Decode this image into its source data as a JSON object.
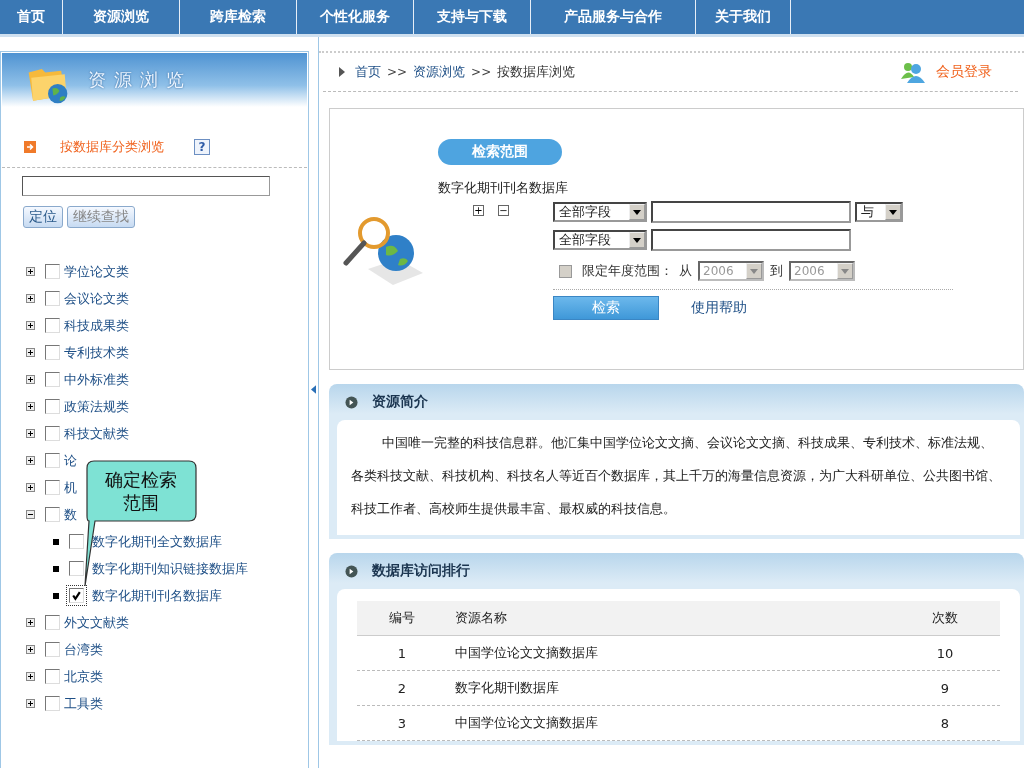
{
  "nav": [
    {
      "label": "首页"
    },
    {
      "label": "资源浏览"
    },
    {
      "label": "跨库检索"
    },
    {
      "label": "个性化服务"
    },
    {
      "label": "支持与下载"
    },
    {
      "label": "产品服务与合作"
    },
    {
      "label": "关于我们"
    }
  ],
  "sidebar": {
    "title": "资源浏览",
    "browse_link": "按数据库分类浏览",
    "help_icon": "?",
    "locate_button": "定位",
    "find_next_button": "继续查找",
    "tree": [
      {
        "label": "学位论文类",
        "expanded": false,
        "checked": false
      },
      {
        "label": "会议论文类",
        "expanded": false,
        "checked": false
      },
      {
        "label": "科技成果类",
        "expanded": false,
        "checked": false
      },
      {
        "label": "专利技术类",
        "expanded": false,
        "checked": false
      },
      {
        "label": "中外标准类",
        "expanded": false,
        "checked": false
      },
      {
        "label": "政策法规类",
        "expanded": false,
        "checked": false
      },
      {
        "label": "科技文献类",
        "expanded": false,
        "checked": false
      },
      {
        "label": "论",
        "expanded": false,
        "checked": false
      },
      {
        "label": "机",
        "expanded": false,
        "checked": false
      },
      {
        "label": "数",
        "expanded": true,
        "checked": false,
        "children": [
          {
            "label": "数字化期刊全文数据库",
            "checked": false
          },
          {
            "label": "数字化期刊知识链接数据库",
            "checked": false
          },
          {
            "label": "数字化期刊刊名数据库",
            "checked": true
          }
        ]
      },
      {
        "label": "外文文献类",
        "expanded": false,
        "checked": false
      },
      {
        "label": "台湾类",
        "expanded": false,
        "checked": false
      },
      {
        "label": "北京类",
        "expanded": false,
        "checked": false
      },
      {
        "label": "工具类",
        "expanded": false,
        "checked": false
      }
    ],
    "callout": "确定检索范围"
  },
  "breadcrumb": [
    {
      "label": "首页"
    },
    {
      "separator": ">>",
      "label": "资源浏览"
    },
    {
      "separator": ">>",
      "label": "按数据库浏览"
    }
  ],
  "login_link": "会员登录",
  "search": {
    "tag": "检索范围",
    "database": "数字化期刊刊名数据库",
    "add": "+",
    "remove": "−",
    "rows": [
      {
        "field": "全部字段",
        "value": "",
        "logic": "与"
      },
      {
        "field": "全部字段",
        "value": ""
      }
    ],
    "year_limit": {
      "checked": false,
      "label": "限定年度范围：",
      "from_label": "从",
      "from": "2006",
      "to_label": "到",
      "to": "2006"
    },
    "search_button": "检索",
    "help_link": "使用帮助"
  },
  "intro": {
    "title": "资源简介",
    "text": "中国唯一完整的科技信息群。他汇集中国学位论文文摘、会议论文文摘、科技成果、专利技术、标准法规、各类科技文献、科技机构、科技名人等近百个数据库，其上千万的海量信息资源，为广大科研单位、公共图书馆、科技工作者、高校师生提供最丰富、最权威的科技信息。"
  },
  "ranking": {
    "title": "数据库访问排行",
    "columns": [
      "编号",
      "资源名称",
      "次数"
    ],
    "rows": [
      [
        "1",
        "中国学位论文文摘数据库",
        "10"
      ],
      [
        "2",
        "数字化期刊数据库",
        "9"
      ],
      [
        "3",
        "中国学位论文文摘数据库",
        "8"
      ]
    ]
  }
}
